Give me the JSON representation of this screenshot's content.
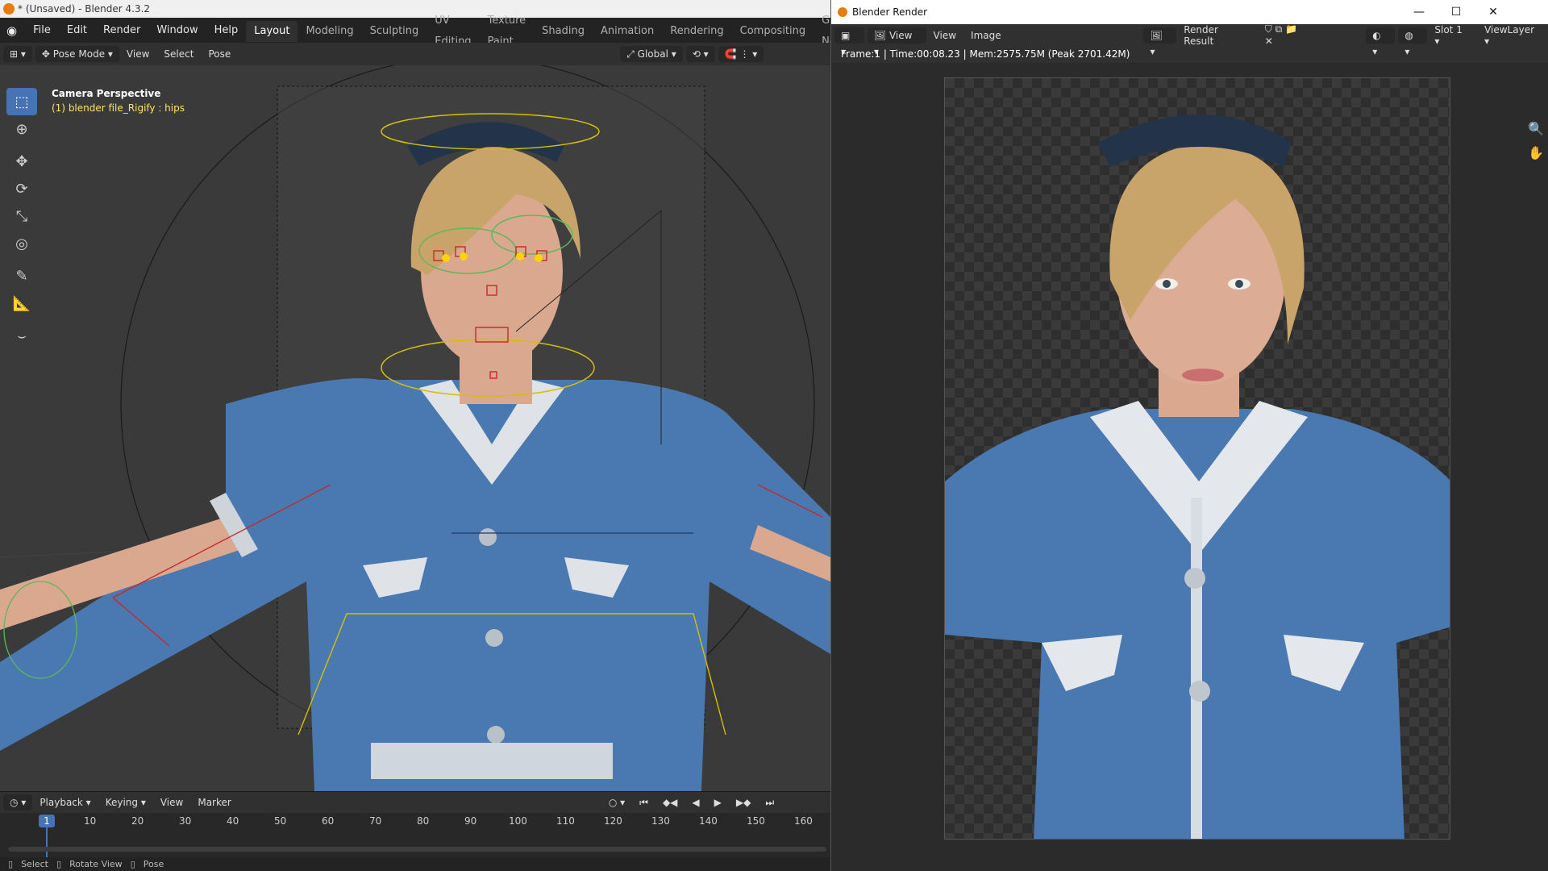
{
  "main": {
    "title": "* (Unsaved) - Blender 4.3.2",
    "menu": [
      "File",
      "Edit",
      "Render",
      "Window",
      "Help"
    ],
    "workspaces": [
      "Layout",
      "Modeling",
      "Sculpting",
      "UV Editing",
      "Texture Paint",
      "Shading",
      "Animation",
      "Rendering",
      "Compositing",
      "Geometry Nodes"
    ],
    "header": {
      "mode": "Pose Mode",
      "menus": [
        "View",
        "Select",
        "Pose"
      ],
      "orientation": "Global"
    },
    "viewport": {
      "camera_label": "Camera Perspective",
      "object_label": "(1) blender file_Rigify : hips"
    },
    "timeline": {
      "menus": [
        "Playback",
        "Keying",
        "View",
        "Marker"
      ],
      "current_frame": "1",
      "ticks": [
        "10",
        "20",
        "30",
        "40",
        "50",
        "60",
        "70",
        "80",
        "90",
        "100",
        "110",
        "120",
        "130",
        "140",
        "150",
        "160"
      ]
    },
    "status": {
      "select": "Select",
      "rotate": "Rotate View",
      "pose": "Pose"
    }
  },
  "render": {
    "title": "Blender Render",
    "menus": [
      "View",
      "View",
      "Image"
    ],
    "image_name": "Render Result",
    "slot": "Slot 1",
    "view_layer": "ViewLayer",
    "info": "Frame:1 | Time:00:08.23 | Mem:2575.75M (Peak 2701.42M)"
  },
  "colors": {
    "accent": "#4772b3",
    "uniform": "#4a78b0",
    "hair": "#c9a46a",
    "skin": "#d9a88f"
  }
}
